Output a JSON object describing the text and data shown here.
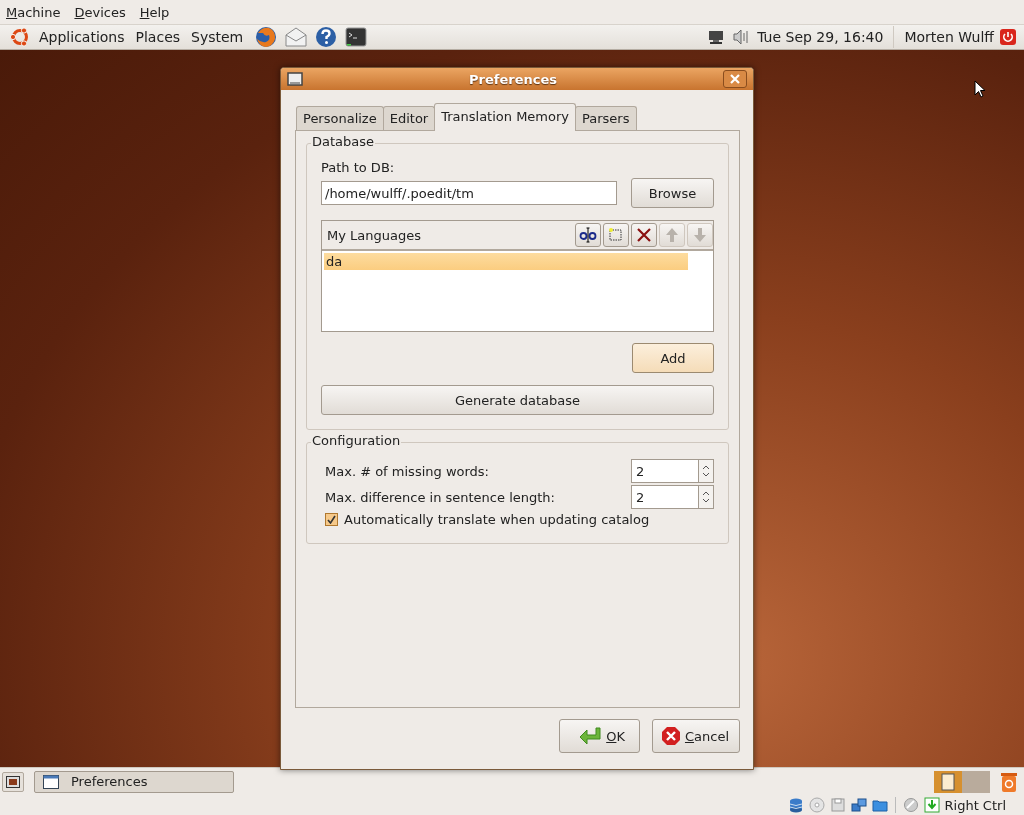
{
  "vbox_menu": [
    {
      "label": "Machine"
    },
    {
      "label": "Devices"
    },
    {
      "label": "Help"
    }
  ],
  "top_panel": {
    "menus": [
      {
        "label": "Applications"
      },
      {
        "label": "Places"
      },
      {
        "label": "System"
      }
    ],
    "launchers": [
      {
        "kind": "browser"
      },
      {
        "kind": "mail"
      },
      {
        "kind": "help"
      },
      {
        "kind": "terminal"
      }
    ],
    "clock": "Tue Sep 29, 16:40",
    "user": "Morten Wulff"
  },
  "dialog": {
    "title": "Preferences",
    "tabs": [
      {
        "label": "Personalize",
        "selected": false
      },
      {
        "label": "Editor",
        "selected": false
      },
      {
        "label": "Translation Memory",
        "selected": true
      },
      {
        "label": "Parsers",
        "selected": false
      }
    ],
    "database": {
      "legend": "Database",
      "path_label": "Path to DB:",
      "path_value": "/home/wulff/.poedit/tm",
      "browse": "Browse",
      "languages": {
        "header": "My Languages",
        "tools": [
          {
            "kind": "edit",
            "disabled": false
          },
          {
            "kind": "new",
            "disabled": false
          },
          {
            "kind": "delete",
            "disabled": false
          },
          {
            "kind": "up",
            "disabled": true
          },
          {
            "kind": "down",
            "disabled": true
          }
        ],
        "items": [
          {
            "label": "da",
            "selected": true
          }
        ]
      },
      "add": {
        "label": "Add",
        "highlighted": true
      },
      "generate": "Generate database"
    },
    "configuration": {
      "legend": "Configuration",
      "fields": [
        {
          "label": "Max. # of missing words:",
          "value": "2"
        },
        {
          "label": "Max. difference in sentence length:",
          "value": "2"
        }
      ],
      "checkbox": {
        "label": "Automatically translate when updating catalog",
        "checked": true
      }
    },
    "buttons": [
      {
        "kind": "ok",
        "label": "OK"
      },
      {
        "kind": "cancel",
        "label": "Cancel"
      }
    ]
  },
  "bottom_panel": {
    "tasks": [
      {
        "label": "Preferences",
        "selected": false
      }
    ]
  },
  "status_bar": {
    "host_key": "Right Ctrl"
  }
}
